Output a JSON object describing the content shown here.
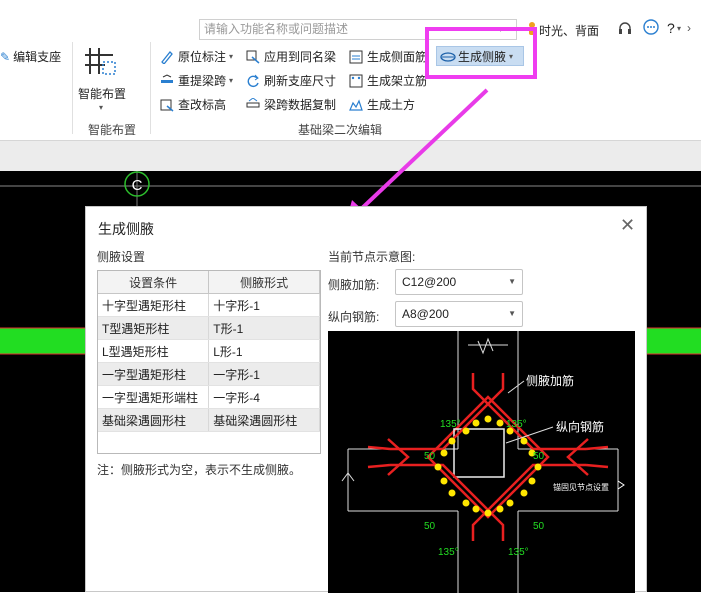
{
  "ribbon": {
    "search_placeholder": "请输入功能名称或问题描述",
    "user_label": "时光、背面",
    "help_label": "?",
    "left_partial_label": "编辑支座",
    "smart_layout_button": "智能布置",
    "smart_layout_group": "智能布置",
    "buttons": {
      "in_place_annotation": "原位标注",
      "re_extract_span": "重提梁跨",
      "check_elevation": "查改标高",
      "apply_same_beam": "应用到同名梁",
      "refresh_support_size": "刷新支座尺寸",
      "span_data_copy": "梁跨数据复制",
      "gen_side_rebar": "生成侧面筋",
      "gen_erection_rebar": "生成架立筋",
      "gen_earthwork": "生成土方",
      "gen_side_haunch": "生成侧腋"
    },
    "group_label": "基础梁二次编辑",
    "highlight_color": "#ef3df0"
  },
  "canvas": {
    "axis_label": "C",
    "beam_color": "#22dd22"
  },
  "dialog": {
    "title": "生成侧腋",
    "settings_label": "侧腋设置",
    "table": {
      "headers": [
        "设置条件",
        "侧腋形式"
      ],
      "rows": [
        [
          "十字型遇矩形柱",
          "十字形-1"
        ],
        [
          "T型遇矩形柱",
          "T形-1"
        ],
        [
          "L型遇矩形柱",
          "L形-1"
        ],
        [
          "一字型遇矩形柱",
          "一字形-1"
        ],
        [
          "一字型遇矩形端柱",
          "一字形-4"
        ],
        [
          "基础梁遇圆形柱",
          "基础梁遇圆形柱"
        ]
      ]
    },
    "note": "注：侧腋形式为空，表示不生成侧腋。",
    "diagram_label": "当前节点示意图:",
    "haunch_rebar_label": "侧腋加筋:",
    "haunch_rebar_value": "C12@200",
    "long_rebar_label": "纵向钢筋:",
    "long_rebar_value": "A8@200",
    "diagram": {
      "callout_haunch": "侧腋加筋",
      "callout_long": "纵向钢筋",
      "angle_label": "135°",
      "dim_label": "50",
      "anchor_label": "锚固见节点设置"
    }
  }
}
